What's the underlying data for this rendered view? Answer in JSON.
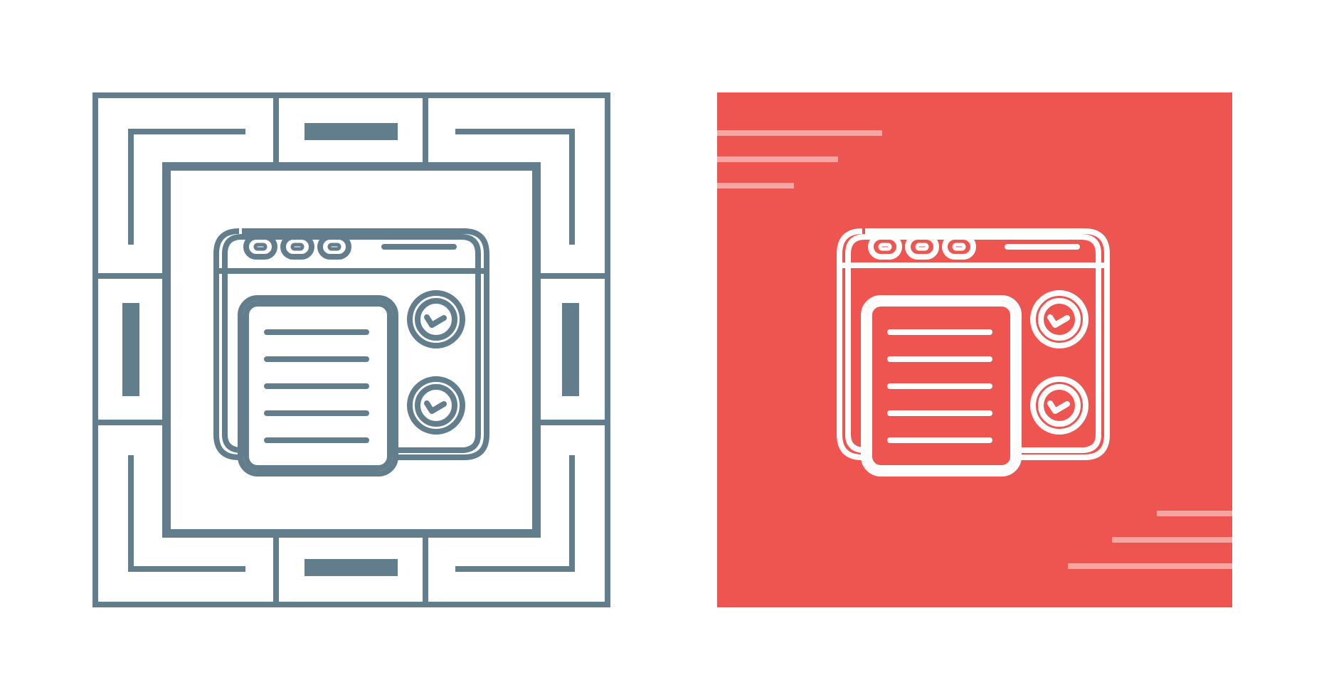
{
  "icons": [
    {
      "id": "line-style",
      "icon": "browser-checklist-icon",
      "variant": "outline",
      "stroke_color": "#627d8c",
      "background_color": "#ffffff"
    },
    {
      "id": "filled-style",
      "icon": "browser-checklist-icon",
      "variant": "filled",
      "stroke_color": "#ffffff",
      "background_color": "#ee5450",
      "accent_line_color": "#f6a5a3"
    }
  ]
}
